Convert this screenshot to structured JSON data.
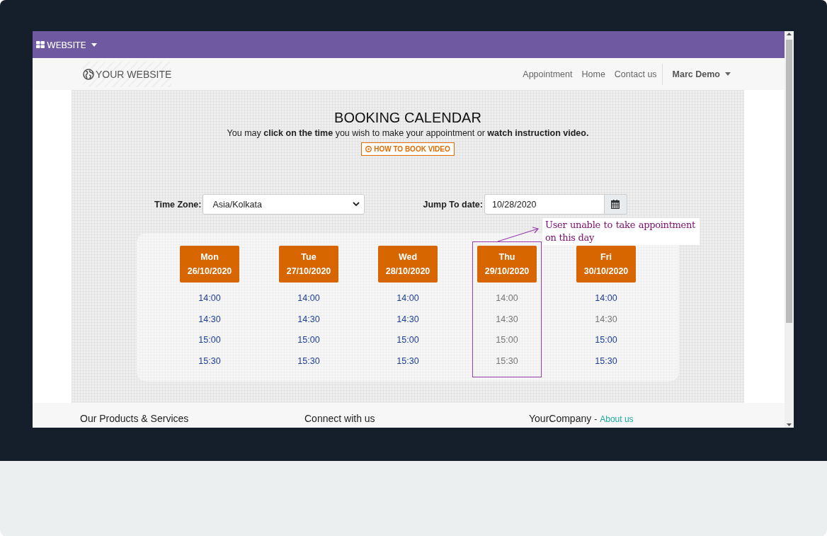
{
  "admin_bar": {
    "menu": "WEBSITE"
  },
  "header": {
    "logo": "YOUR WEBSITE",
    "nav": [
      {
        "label": "Appointment"
      },
      {
        "label": "Home"
      },
      {
        "label": "Contact us"
      }
    ],
    "user": "Marc Demo"
  },
  "booking": {
    "title": "BOOKING CALENDAR",
    "intro": "You may **click on the time** you wish to make your appointment or **watch instruction video.**",
    "video_button": "HOW TO BOOK VIDEO",
    "time_zone": {
      "label": "Time Zone:",
      "value": "Asia/Kolkata"
    },
    "jump_to_date": {
      "label": "Jump To date:",
      "value": "10/28/2020"
    },
    "days": [
      {
        "weekday": "Mon",
        "date": "26/10/2020",
        "slots": [
          {
            "time": "14:00",
            "available": true
          },
          {
            "time": "14:30",
            "available": true
          },
          {
            "time": "15:00",
            "available": true
          },
          {
            "time": "15:30",
            "available": true
          }
        ]
      },
      {
        "weekday": "Tue",
        "date": "27/10/2020",
        "slots": [
          {
            "time": "14:00",
            "available": true
          },
          {
            "time": "14:30",
            "available": true
          },
          {
            "time": "15:00",
            "available": true
          },
          {
            "time": "15:30",
            "available": true
          }
        ]
      },
      {
        "weekday": "Wed",
        "date": "28/10/2020",
        "slots": [
          {
            "time": "14:00",
            "available": true
          },
          {
            "time": "14:30",
            "available": true
          },
          {
            "time": "15:00",
            "available": true
          },
          {
            "time": "15:30",
            "available": true
          }
        ]
      },
      {
        "weekday": "Thu",
        "date": "29/10/2020",
        "slots": [
          {
            "time": "14:00",
            "available": false
          },
          {
            "time": "14:30",
            "available": false
          },
          {
            "time": "15:00",
            "available": false
          },
          {
            "time": "15:30",
            "available": false
          }
        ]
      },
      {
        "weekday": "Fri",
        "date": "30/10/2020",
        "slots": [
          {
            "time": "14:00",
            "available": true
          },
          {
            "time": "14:30",
            "available": false
          },
          {
            "time": "15:00",
            "available": true
          },
          {
            "time": "15:30",
            "available": true
          }
        ]
      }
    ],
    "annotation": {
      "text": "User unable to take appointment on this day"
    }
  },
  "footer": {
    "columns": [
      {
        "heading": "Our Products & Services"
      },
      {
        "heading": "Connect with us"
      },
      {
        "heading": "YourCompany",
        "separator": "-",
        "link": "About us"
      }
    ]
  }
}
